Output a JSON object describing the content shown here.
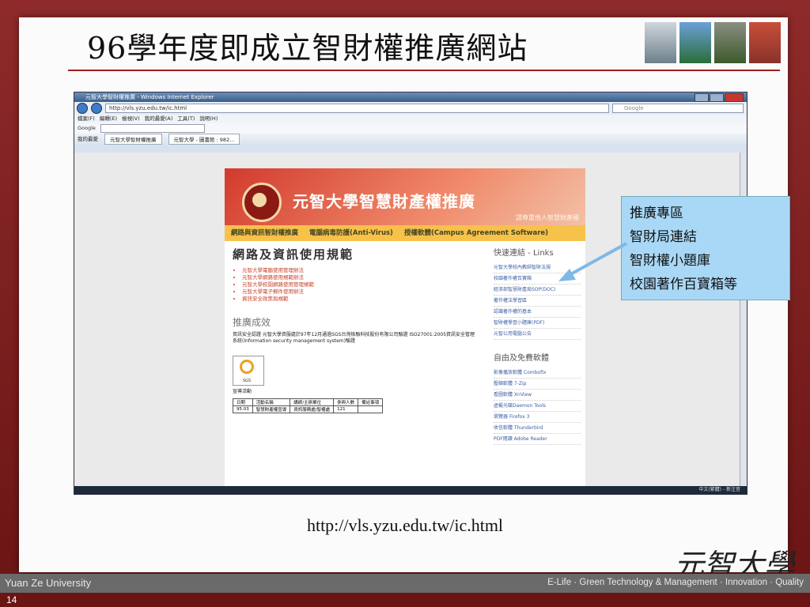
{
  "slide": {
    "title": "96學年度即成立智財權推廣網站",
    "caption": "http://vls.yzu.edu.tw/ic.html",
    "page_number": "14"
  },
  "callout": {
    "lines": [
      "推廣專區",
      "智財局連結",
      "智財權小題庫",
      "校園著作百寶箱等"
    ]
  },
  "footer": {
    "left": "Yuan Ze University",
    "right": "E-Life · Green Technology & Management · Innovation · Quality"
  },
  "logo": {
    "text": "元智大學"
  },
  "browser": {
    "window_title": "元智大學智財權推廣 - Windows Internet Explorer",
    "url": "http://vls.yzu.edu.tw/ic.html",
    "search_placeholder": "Google",
    "menu": "檔案(F) 編輯(E) 檢視(V) 我的最愛(A) 工具(T) 說明(H)",
    "google_label": "Google",
    "favorites": "我的最愛",
    "tab_active": "元智大學智財權推廣",
    "tab_other": "元智大學 - 圖書館 : 982...",
    "status": "中文(繁體) - 新注音"
  },
  "webpage": {
    "banner_title": "元智大學智慧財產權推廣",
    "banner_subtitle": "請尊重他人智慧財產權",
    "nav": [
      "網路與資訊智財權推廣",
      "電腦病毒防護(Anti-Virus)",
      "授權軟體(Campus Agreement Software)"
    ],
    "heading": "網路及資訊使用規範",
    "rules": [
      "元智大學電腦使用管理辦法",
      "元智大學網路使用規範辦法",
      "元智大學校園網路使用管理規範",
      "元智大學電子郵件使用辦法",
      "資訊安全政策與規範"
    ],
    "achievement_heading": "推廣成效",
    "achievement_text": "資訊安全認證 元智大學資服處於97年12月通過SGS台灣檢驗科技股份有限公司驗證 ISO27001:2005資訊安全管理系統(Information security management system)驗證",
    "activity_label": "宣導活動",
    "table_headers": [
      "日期",
      "活動名稱",
      "講師/主辦單位",
      "參與人數",
      "備註事項"
    ],
    "table_row": [
      "95.03",
      "智慧財產權宣導",
      "資訊服務處/智權處",
      "121",
      ""
    ],
    "quick_links_heading": "快速連結 - Links",
    "quick_links": [
      "元智大學校內教師智財法規",
      "校園著作權百寶箱",
      "經濟部智慧財產局SOP(DOC)",
      "著作權法學習區",
      "認識著作權的基本",
      "智財權學習小題庫(PDF)",
      "元智公用電腦公告"
    ],
    "free_software_heading": "自由及免費軟體",
    "free_software": [
      "影像播放軟體 Combofix",
      "壓縮軟體 7-Zip",
      "看圖軟體 XnView",
      "虛擬光碟Daemon Tools",
      "瀏覽器 Firefox 3",
      "收信軟體 Thunderbird",
      "PDF閱讀 Adobe Reader"
    ]
  }
}
